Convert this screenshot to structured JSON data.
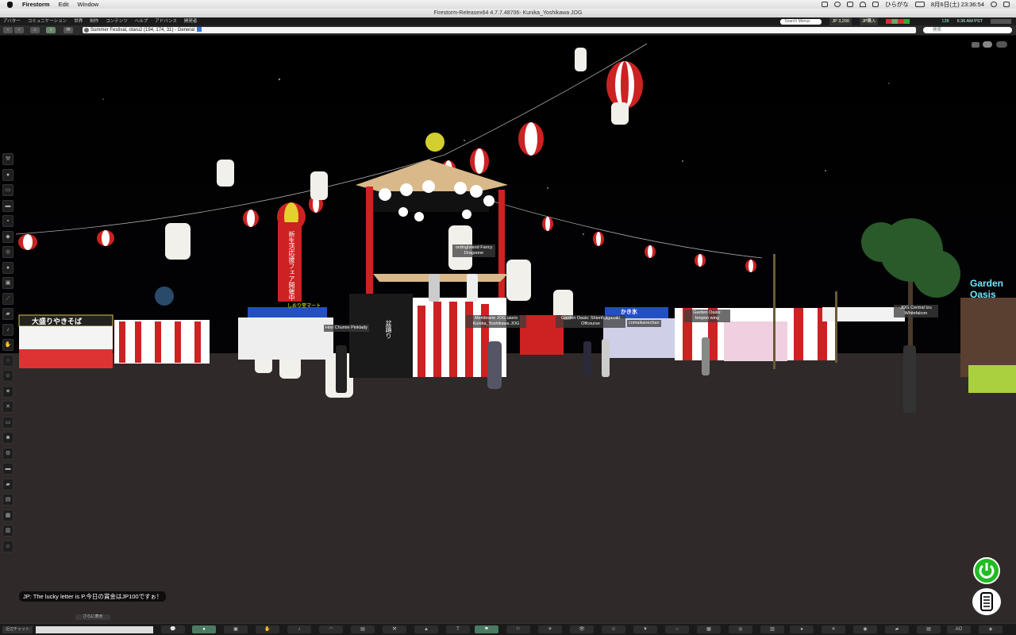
{
  "menubar": {
    "app": "Firestorm",
    "items": [
      "Edit",
      "Window"
    ],
    "input_method": "ひらがな",
    "clock": "8月6日(土) 23:36:54"
  },
  "window_title": "Firestorm-Releasex64 4.7.7.48706- Kunika_Yoshikawa JOG",
  "fs_menu": {
    "items": [
      "アバター",
      "コミュニケーション",
      "世界",
      "制作",
      "コンテンツ",
      "ヘルプ",
      "アドバンス",
      "開発者"
    ],
    "search_placeholder": "Search Menus",
    "balance": "JP 3,200",
    "buy": "JP購入",
    "fps": "128",
    "time": "6:36 AM PST"
  },
  "navbar": {
    "location": "Summer Festival, otaru2 (194, 174, 31) - General",
    "search_placeholder": "検索"
  },
  "name_tags": [
    "ordingIsland Fancy Dragoone",
    "Membrane JOG users Kunika_Yoshikawa JOG",
    "Garden Oasis: Shionfujigasaki Offcourse",
    "comaikanechan",
    "Garden Oasis: brepon wing",
    "Hoo Chumie Pinklady",
    "JOG Central Izu Whitefalcon"
  ],
  "scene_signs": {
    "stall_left": "大盛りやきそば",
    "banner": "新生活応援フェア開催中",
    "shop": "しおり堂マート",
    "kakigori": "かき氷",
    "garden": "Garden Oasis",
    "dance": "盆踊り"
  },
  "chat": {
    "message": "JP: The lucky letter is P.今日の賞金はJP100ですぉ！",
    "more_label": "さらに表示",
    "nearby_label": "近辺チャット"
  },
  "bottom_toolbar": {
    "ao_label": "AO"
  }
}
